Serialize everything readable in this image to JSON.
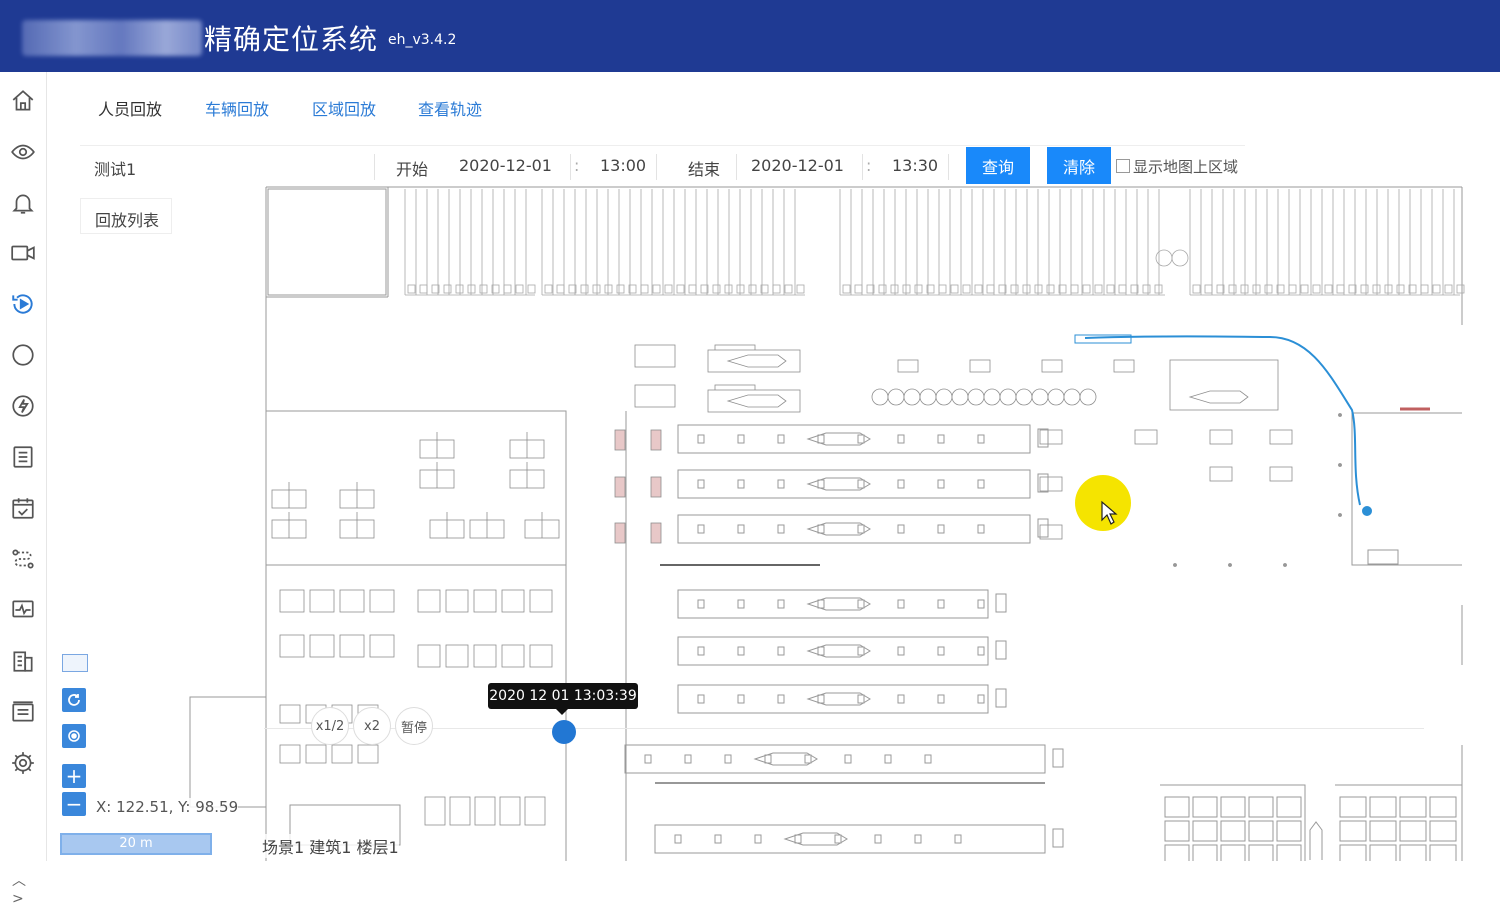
{
  "header": {
    "title": "精确定位系统",
    "version": "eh_v3.4.2"
  },
  "sidebar": {
    "items": [
      {
        "icon": "home-icon"
      },
      {
        "icon": "eye-icon"
      },
      {
        "icon": "bell-icon"
      },
      {
        "icon": "video-icon"
      },
      {
        "icon": "playback-icon",
        "active": true
      },
      {
        "icon": "circle-icon"
      },
      {
        "icon": "lightning-icon"
      },
      {
        "icon": "list-icon"
      },
      {
        "icon": "calendar-check-icon"
      },
      {
        "icon": "route-icon"
      },
      {
        "icon": "monitor-icon"
      },
      {
        "icon": "building-icon"
      },
      {
        "icon": "report-icon"
      },
      {
        "icon": "gear-icon"
      }
    ]
  },
  "tabs": [
    {
      "label": "人员回放",
      "active": false
    },
    {
      "label": "车辆回放",
      "active": true
    },
    {
      "label": "区域回放",
      "active": true
    },
    {
      "label": "查看轨迹",
      "active": true
    }
  ],
  "query": {
    "target": "测试1",
    "start_label": "开始",
    "start_date": "2020-12-01",
    "start_time": "13:00",
    "end_label": "结束",
    "end_date": "2020-12-01",
    "end_time": "13:30",
    "query_button": "查询",
    "clear_button": "清除",
    "show_area_label": "显示地图上区域"
  },
  "playlist_label": "回放列表",
  "playback": {
    "timestamp": "2020 12 01 13:03:39",
    "speeds": [
      "x1/2",
      "x2",
      "暂停"
    ]
  },
  "coords": {
    "x_label": "X:",
    "x": "122.51,",
    "y_label": "Y:",
    "y": "98.59"
  },
  "scale": "20 m",
  "scene": "场景1 建筑1 楼层1",
  "colors": {
    "header_bg": "#1f3a93",
    "accent": "#1989fa",
    "track": "#2b8fd6"
  }
}
